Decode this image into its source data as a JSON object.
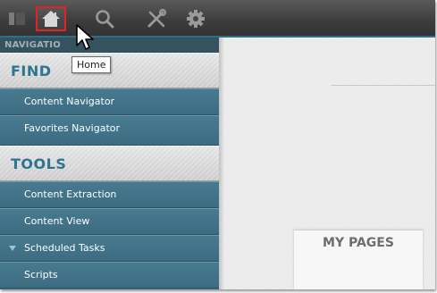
{
  "toolbar": {
    "buttons": [
      {
        "name": "panel-toggle-icon"
      },
      {
        "name": "home-icon",
        "tooltip": "Home",
        "highlighted": true
      },
      {
        "name": "search-icon"
      },
      {
        "name": "tools-icon"
      },
      {
        "name": "gear-icon"
      }
    ],
    "accent_color": "#2f6f86",
    "highlight_color": "#e02424"
  },
  "tooltip": {
    "text": "Home"
  },
  "sidebar": {
    "header_label": "NAVIGATIO",
    "find": {
      "label": "FIND",
      "items": [
        {
          "label": "Content Navigator"
        },
        {
          "label": "Favorites Navigator"
        }
      ]
    },
    "tools": {
      "label": "TOOLS",
      "items": [
        {
          "label": "Content Extraction"
        },
        {
          "label": "Content View"
        },
        {
          "label": "Scheduled Tasks",
          "expandable": true
        },
        {
          "label": "Scripts"
        }
      ]
    },
    "item_color": "#3f6f84",
    "section_label_color": "#2e7593"
  },
  "main": {
    "tab_label": "MY PAGES"
  }
}
